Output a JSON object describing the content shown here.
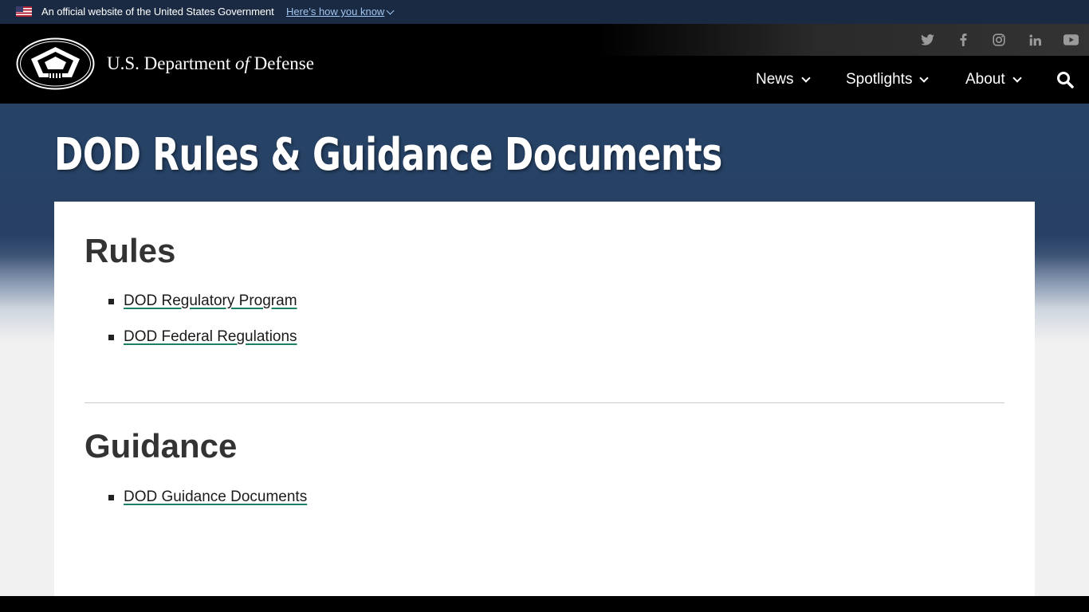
{
  "gov_banner": {
    "official_text": "An official website of the United States Government",
    "how_you_know": "Here’s how you know"
  },
  "header": {
    "title_prefix": "U.S. Department ",
    "title_of": "of",
    "title_suffix": " Defense",
    "social_icons": [
      "twitter-icon",
      "facebook-icon",
      "instagram-icon",
      "linkedin-icon",
      "youtube-icon"
    ],
    "nav": [
      {
        "label": "News"
      },
      {
        "label": "Spotlights"
      },
      {
        "label": "About"
      }
    ]
  },
  "page": {
    "title": "DOD Rules & Guidance Documents"
  },
  "sections": {
    "rules": {
      "heading": "Rules",
      "links": [
        "DOD Regulatory Program",
        "DOD Federal Regulations"
      ]
    },
    "guidance": {
      "heading": "Guidance",
      "links": [
        "DOD Guidance Documents"
      ]
    }
  },
  "colors": {
    "banner_bg": "#1b2a43",
    "hero_blue": "#264366",
    "link_underline": "#1a7f64"
  }
}
